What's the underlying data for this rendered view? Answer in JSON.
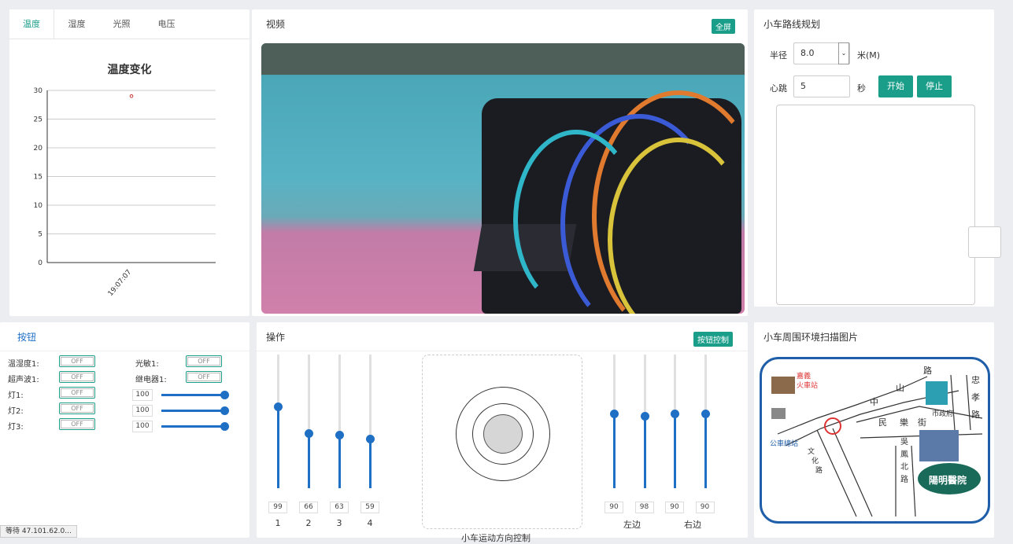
{
  "tabs": [
    {
      "label": "温度",
      "active": true
    },
    {
      "label": "湿度",
      "active": false
    },
    {
      "label": "光照",
      "active": false
    },
    {
      "label": "电压",
      "active": false
    }
  ],
  "chart_data": {
    "type": "scatter",
    "title": "温度变化",
    "xlabel": "",
    "ylabel": "",
    "categories": [
      "19:07:07"
    ],
    "values": [
      29
    ],
    "ylim": [
      0,
      30
    ],
    "yticks": [
      "0",
      "5",
      "10",
      "15",
      "20",
      "25",
      "30"
    ],
    "grid": true,
    "colors": {
      "point": "#c23531"
    }
  },
  "video": {
    "title": "视频",
    "button": "全屏"
  },
  "route": {
    "title": "小车路线规划",
    "radius_label": "半径",
    "radius_value": "8.0",
    "radius_unit": "米(M)",
    "speed_label": "心跳",
    "speed_value": "5",
    "speed_unit": "秒",
    "start": "开始",
    "stop": "停止"
  },
  "buttons_panel": {
    "title": "按钮",
    "switches": [
      {
        "label": "温湿度1:",
        "state": "OFF"
      },
      {
        "label": "超声波1:",
        "state": "OFF"
      },
      {
        "label": "灯1:",
        "state": "OFF"
      },
      {
        "label": "灯2:",
        "state": "OFF"
      },
      {
        "label": "灯3:",
        "state": "OFF"
      },
      {
        "label": "光敏1:",
        "state": "OFF"
      },
      {
        "label": "继电器1:",
        "state": "OFF"
      }
    ],
    "sliders": [
      {
        "value": "100",
        "fraction": 1.0
      },
      {
        "value": "100",
        "fraction": 1.0
      },
      {
        "value": "100",
        "fraction": 1.0
      }
    ]
  },
  "operation": {
    "title": "操作",
    "button": "按钮控制",
    "left_sliders": [
      {
        "value": "99",
        "label": "1",
        "fraction": 0.61
      },
      {
        "value": "66",
        "label": "2",
        "fraction": 0.41
      },
      {
        "value": "63",
        "label": "3",
        "fraction": 0.4
      },
      {
        "value": "59",
        "label": "4",
        "fraction": 0.37
      }
    ],
    "right_sliders": [
      {
        "value": "90",
        "fraction": 0.56
      },
      {
        "value": "98",
        "fraction": 0.54
      },
      {
        "value": "90",
        "fraction": 0.56
      },
      {
        "value": "90",
        "fraction": 0.56
      }
    ],
    "left_caption": "左边",
    "right_caption": "右边",
    "joystick_caption": "小车运动方向控制"
  },
  "scan": {
    "title": "小车周围环境扫描图片",
    "map_labels": {
      "station_top": "嘉義",
      "station_top2": "火車站",
      "bus": "公車總站",
      "gov": "市政府",
      "hospital": "陽明醫院",
      "road1": "路",
      "road2": "山",
      "road3": "中",
      "road4": "民",
      "road5": "樂",
      "road6": "街",
      "road7": "忠",
      "road8": "孝",
      "road9": "路",
      "road10": "吳",
      "road11": "鳳",
      "road12": "北",
      "road13": "路",
      "road14": "文",
      "road15": "化",
      "road16": "路"
    }
  },
  "status_bar": "等待 47.101.62.0..."
}
